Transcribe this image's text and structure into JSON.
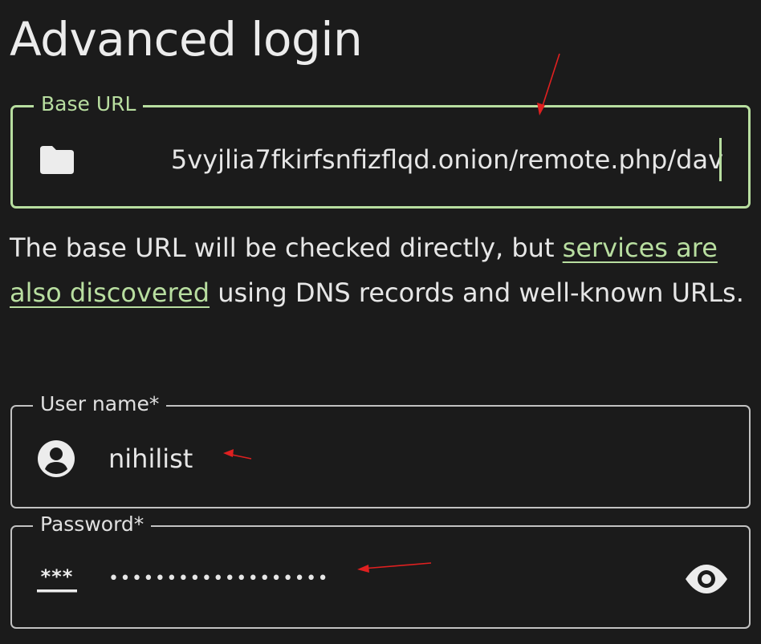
{
  "page": {
    "title": "Advanced login"
  },
  "base_url": {
    "label": "Base URL",
    "value": "5vyjlia7fkirfsnfizflqd.onion/remote.php/dav",
    "icon": "folder-icon"
  },
  "help": {
    "text_before": "The base URL will be checked directly, but ",
    "link_text": "services are also discovered",
    "text_after": " using DNS records and well-known URLs."
  },
  "username": {
    "label": "User name*",
    "value": "nihilist",
    "icon": "account-circle-icon"
  },
  "password": {
    "label": "Password*",
    "masked_value": "•••••••••••••••••••",
    "icon": "password-icon",
    "toggle_icon": "eye-icon"
  },
  "colors": {
    "accent": "#b8dea0",
    "background": "#1b1b1b",
    "text": "#e6e6e6",
    "annotation_arrow": "#e02020"
  }
}
